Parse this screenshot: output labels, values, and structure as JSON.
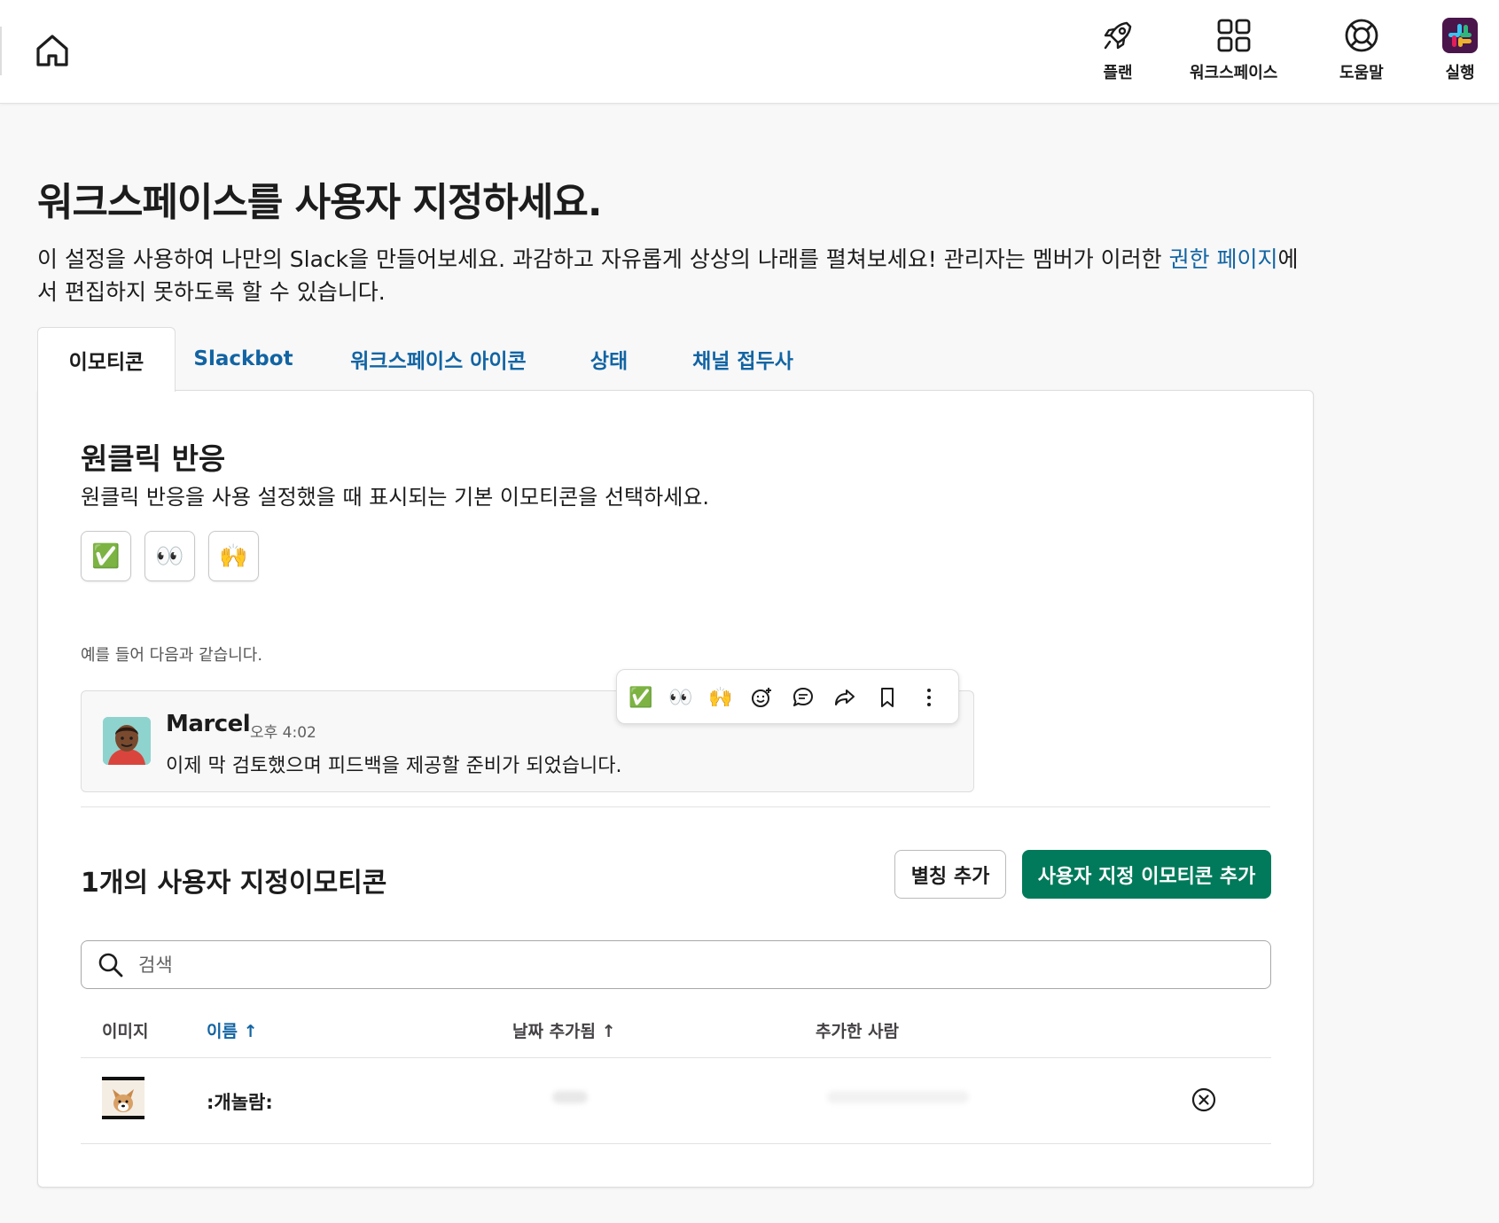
{
  "topbar": {
    "nav": [
      {
        "label": "플랜",
        "icon": "rocket-icon"
      },
      {
        "label": "워크스페이스",
        "icon": "grid-icon"
      },
      {
        "label": "도움말",
        "icon": "lifebuoy-icon"
      },
      {
        "label": "실행",
        "icon": "slack-logo-icon"
      }
    ]
  },
  "page": {
    "title": "워크스페이스를 사용자 지정하세요.",
    "intro_before": "이 설정을 사용하여 나만의 Slack을 만들어보세요. 과감하고 자유롭게 상상의 나래를 펼쳐보세요! 관리자는 멤버가 이러한 ",
    "intro_link": "권한 페이지",
    "intro_after": "에서 편집하지 못하도록 할 수 있습니다."
  },
  "tabs": [
    {
      "label": "이모티콘",
      "active": true
    },
    {
      "label": "Slackbot",
      "active": false
    },
    {
      "label": "워크스페이스 아이콘",
      "active": false
    },
    {
      "label": "상태",
      "active": false
    },
    {
      "label": "채널 접두사",
      "active": false
    }
  ],
  "one_click": {
    "title": "원클릭 반응",
    "description": "원클릭 반응을 사용 설정했을 때 표시되는 기본 이모티콘을 선택하세요.",
    "emojis": [
      "✅",
      "👀",
      "🙌"
    ],
    "example_label": "예를 들어 다음과 같습니다."
  },
  "example_message": {
    "author": "Marcel",
    "time": "오후 4:02",
    "text": "이제 막 검토했으며 피드백을 제공할 준비가 되었습니다.",
    "hover_emojis": [
      "✅",
      "👀",
      "🙌"
    ]
  },
  "custom_emoji": {
    "title": "1개의 사용자 지정이모티콘",
    "alias_button": "별칭 추가",
    "add_button": "사용자 지정 이모티콘 추가",
    "search_placeholder": "검색",
    "columns": {
      "image": "이미지",
      "name": "이름 ↑",
      "date_added": "날짜 추가됨 ↑",
      "added_by": "추가한 사람"
    },
    "rows": [
      {
        "name": ":개놀람:"
      }
    ]
  },
  "colors": {
    "link": "#1264a3",
    "primary_button": "#007a5a"
  }
}
